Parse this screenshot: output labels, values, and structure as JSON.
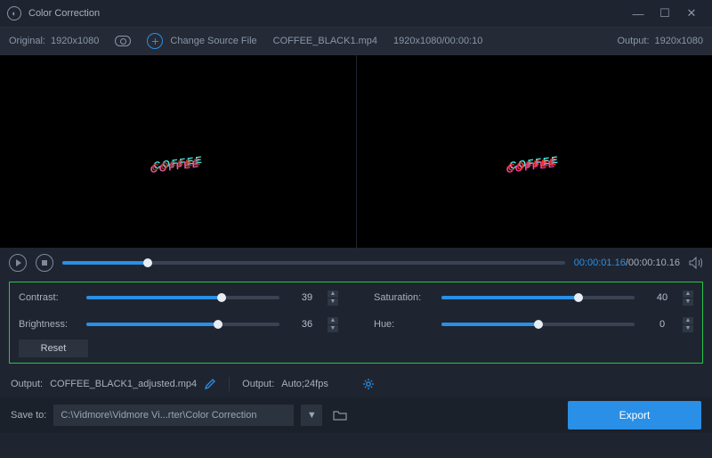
{
  "titlebar": {
    "title": "Color Correction"
  },
  "info": {
    "original_label": "Original:",
    "original_res": "1920x1080",
    "change_source_label": "Change Source File",
    "filename": "COFFEE_BLACK1.mp4",
    "dims_time": "1920x1080/00:00:10",
    "output_label": "Output:",
    "output_res": "1920x1080"
  },
  "preview_text": "COFFEE",
  "playbar": {
    "time_current": "00:00:01.16",
    "time_total": "/00:00:10.16",
    "seek_percent": 17
  },
  "controls": {
    "contrast": {
      "label": "Contrast:",
      "value": 39,
      "fill": 70
    },
    "brightness": {
      "label": "Brightness:",
      "value": 36,
      "fill": 68
    },
    "saturation": {
      "label": "Saturation:",
      "value": 40,
      "fill": 71
    },
    "hue": {
      "label": "Hue:",
      "value": 0,
      "fill": 50
    },
    "reset_label": "Reset"
  },
  "output_row": {
    "output_file_label": "Output:",
    "output_file": "COFFEE_BLACK1_adjusted.mp4",
    "settings_label": "Output:",
    "settings_value": "Auto;24fps"
  },
  "save_row": {
    "label": "Save to:",
    "path": "C:\\Vidmore\\Vidmore Vi...rter\\Color Correction",
    "export_label": "Export"
  }
}
